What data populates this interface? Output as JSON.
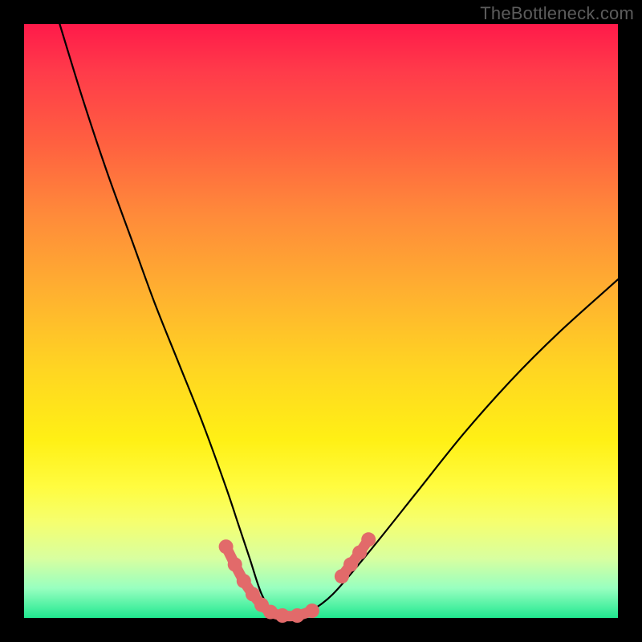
{
  "watermark": "TheBottleneck.com",
  "chart_data": {
    "type": "line",
    "title": "",
    "xlabel": "",
    "ylabel": "",
    "xlim": [
      0,
      100
    ],
    "ylim": [
      0,
      100
    ],
    "grid": false,
    "note": "Gradient background red→green top→bottom. Single black V-shaped curve with pink bead segment overlaid at the trough and lower-right rise.",
    "curve": {
      "name": "bottleneck-curve",
      "x": [
        6,
        10,
        14,
        18,
        22,
        26,
        30,
        34,
        36,
        38,
        40,
        42,
        44,
        46,
        48,
        52,
        58,
        66,
        74,
        82,
        90,
        100
      ],
      "y": [
        100,
        87,
        75,
        64,
        53,
        43,
        33,
        22,
        16,
        10,
        4,
        1,
        0,
        0,
        1,
        4,
        11,
        21,
        31,
        40,
        48,
        57
      ]
    },
    "beads_left": {
      "color": "#e26a6a",
      "x": [
        34.0,
        35.5,
        37.0,
        38.5,
        40.0,
        41.5,
        43.5,
        46.0,
        48.5
      ],
      "y": [
        12.0,
        9.0,
        6.2,
        4.0,
        2.2,
        1.0,
        0.4,
        0.4,
        1.2
      ]
    },
    "beads_right": {
      "color": "#e26a6a",
      "x": [
        53.5,
        55.0,
        56.5,
        58.0
      ],
      "y": [
        7.0,
        9.0,
        11.0,
        13.2
      ]
    },
    "gradient_stops": [
      {
        "pct": 0,
        "color": "#ff1a4a"
      },
      {
        "pct": 20,
        "color": "#ff6040"
      },
      {
        "pct": 45,
        "color": "#ffb030"
      },
      {
        "pct": 70,
        "color": "#fff015"
      },
      {
        "pct": 90,
        "color": "#d8ffa0"
      },
      {
        "pct": 100,
        "color": "#20e890"
      }
    ]
  }
}
